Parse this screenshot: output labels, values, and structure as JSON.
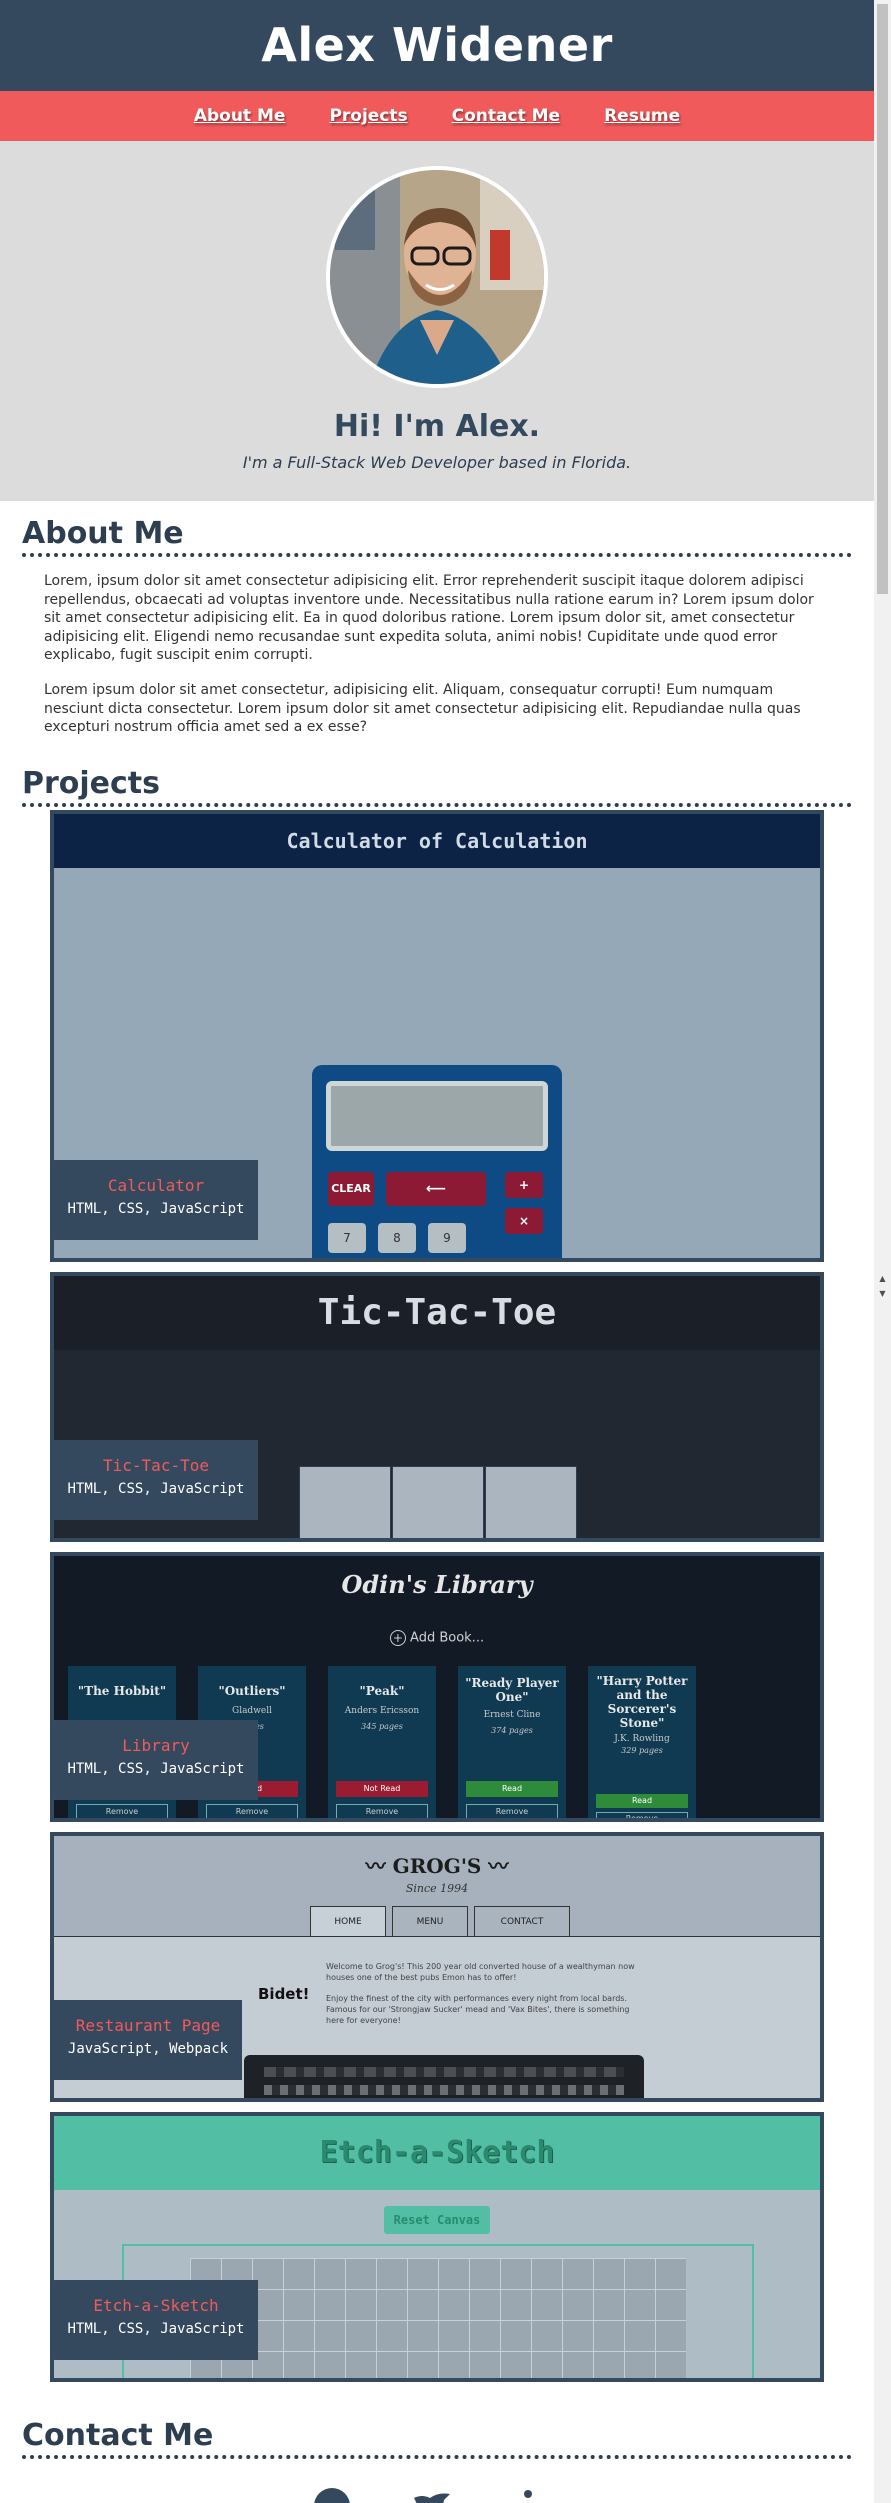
{
  "header": {
    "title": "Alex Widener"
  },
  "nav": {
    "items": [
      "About Me",
      "Projects",
      "Contact Me",
      "Resume"
    ]
  },
  "hero": {
    "greeting": "Hi! I'm Alex.",
    "tagline": "I'm a Full-Stack Web Developer based in Florida."
  },
  "about": {
    "title": "About Me",
    "paragraphs": [
      "Lorem, ipsum dolor sit amet consectetur adipisicing elit. Error reprehenderit suscipit itaque dolorem adipisci repellendus, obcaecati ad voluptas inventore unde. Necessitatibus nulla ratione earum in? Lorem ipsum dolor sit amet consectetur adipisicing elit. Ea in quod doloribus ratione. Lorem ipsum dolor sit, amet consectetur adipisicing elit. Eligendi nemo recusandae sunt expedita soluta, animi nobis! Cupiditate unde quod error explicabo, fugit suscipit enim corrupti.",
      "Lorem ipsum dolor sit amet consectetur, adipisicing elit. Aliquam, consequatur corrupti! Eum numquam nesciunt dicta consectetur. Lorem ipsum dolor sit amet consectetur adipisicing elit. Repudiandae nulla quas excepturi nostrum officia amet sed a ex esse?"
    ]
  },
  "projects": {
    "title": "Projects",
    "items": [
      {
        "name": "Calculator",
        "tech": "HTML, CSS, JavaScript",
        "preview": {
          "title": "Calculator of Calculation",
          "keys": [
            "CLEAR",
            "⟵",
            "+",
            "×",
            "7",
            "8",
            "9"
          ]
        }
      },
      {
        "name": "Tic-Tac-Toe",
        "tech": "HTML, CSS, JavaScript",
        "preview": {
          "title": "Tic-Tac-Toe"
        }
      },
      {
        "name": "Library",
        "tech": "HTML, CSS, JavaScript",
        "preview": {
          "title": "Odin's Library",
          "add": "Add Book...",
          "books": [
            {
              "title": "\"The Hobbit\"",
              "author": "",
              "pages": "",
              "status": "",
              "remove": "Remove"
            },
            {
              "title": "\"Outliers\"",
              "author": "Gladwell",
              "pages": "pages",
              "status": "Read",
              "remove": "Remove"
            },
            {
              "title": "\"Peak\"",
              "author": "Anders Ericsson",
              "pages": "345 pages",
              "status": "Not Read",
              "remove": "Remove"
            },
            {
              "title": "\"Ready Player One\"",
              "author": "Ernest Cline",
              "pages": "374 pages",
              "status": "Read",
              "remove": "Remove"
            },
            {
              "title": "\"Harry Potter and the Sorcerer's Stone\"",
              "author": "J.K. Rowling",
              "pages": "329 pages",
              "status": "Read",
              "remove": "Remove"
            }
          ]
        }
      },
      {
        "name": "Restaurant Page",
        "tech": "JavaScript, Webpack",
        "preview": {
          "brand": "GROG'S",
          "since": "Since 1994",
          "tabs": [
            "HOME",
            "MENU",
            "CONTACT"
          ],
          "heading": "Bidet!",
          "body1": "Welcome to Grog's! This 200 year old converted house of a wealthyman now houses one of the best pubs Emon has to offer!",
          "body2": "Enjoy the finest of the city with performances every night from local bards. Famous for our 'Strongjaw Sucker' mead and 'Vax Bites', there is something here for everyone!"
        }
      },
      {
        "name": "Etch-a-Sketch",
        "tech": "HTML, CSS, JavaScript",
        "preview": {
          "title": "Etch-a-Sketch",
          "button": "Reset Canvas"
        }
      }
    ]
  },
  "contact": {
    "title": "Contact Me"
  },
  "colors": {
    "navy": "#34495e",
    "accent": "#f05a5b",
    "hero_bg": "#dcdcdc"
  }
}
